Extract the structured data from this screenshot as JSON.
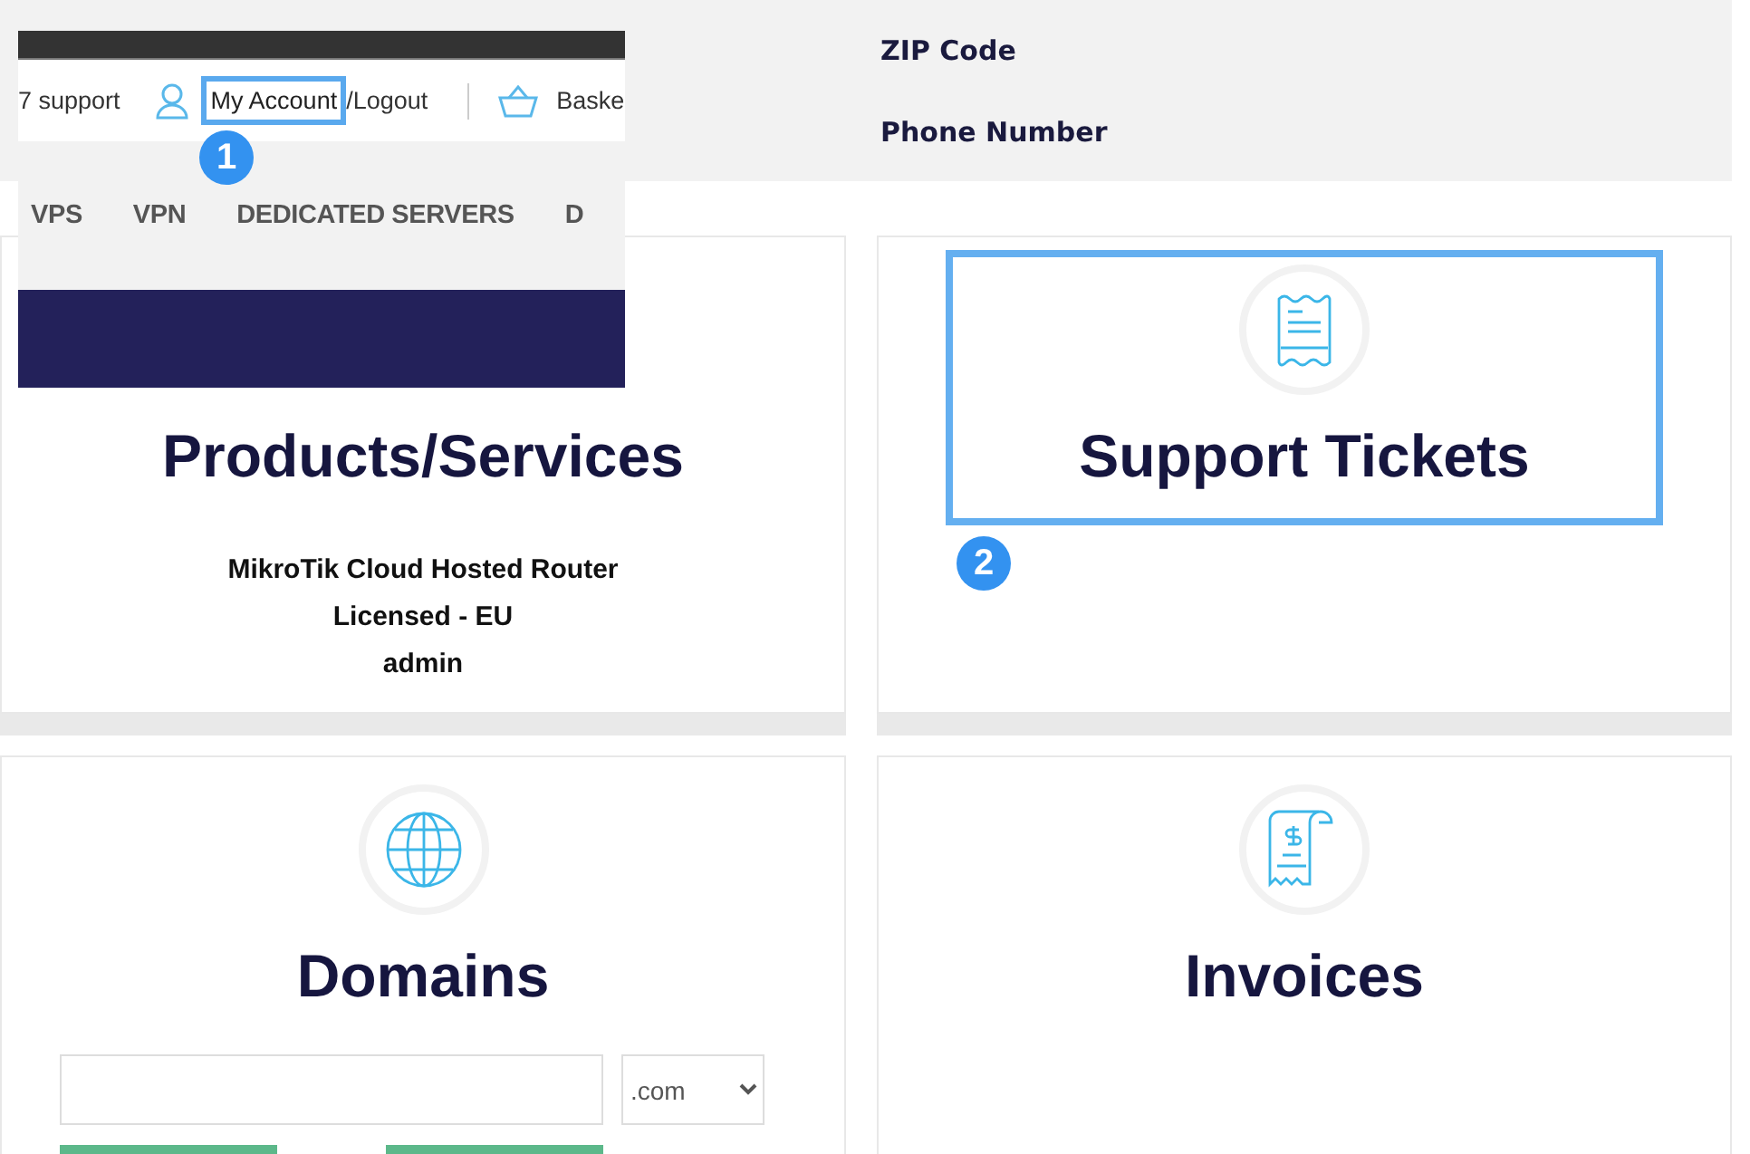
{
  "address_fields": [
    {
      "label": "ZIP Code"
    },
    {
      "label": "Phone Number"
    }
  ],
  "header_inset": {
    "support_text": "7 support",
    "account_link": {
      "label": "My Account",
      "highlighted": true
    },
    "logout_link": "/Logout",
    "basket_link": "Baske",
    "callout": "1",
    "nav": [
      {
        "label": "VPS"
      },
      {
        "label": "VPN"
      },
      {
        "label": "DEDICATED SERVERS"
      },
      {
        "label": "D"
      }
    ]
  },
  "cards": [
    {
      "kind": "services",
      "title": "Products/Services",
      "highlighted": false,
      "lines": [
        "MikroTik Cloud Hosted Router",
        "Licensed - EU",
        "admin"
      ]
    },
    {
      "kind": "tickets",
      "title": "Support Tickets",
      "highlighted": true,
      "callout": "2"
    },
    {
      "kind": "domains",
      "title": "Domains",
      "highlighted": false,
      "tld": ".com"
    },
    {
      "kind": "invoices",
      "title": "Invoices",
      "highlighted": false
    }
  ]
}
